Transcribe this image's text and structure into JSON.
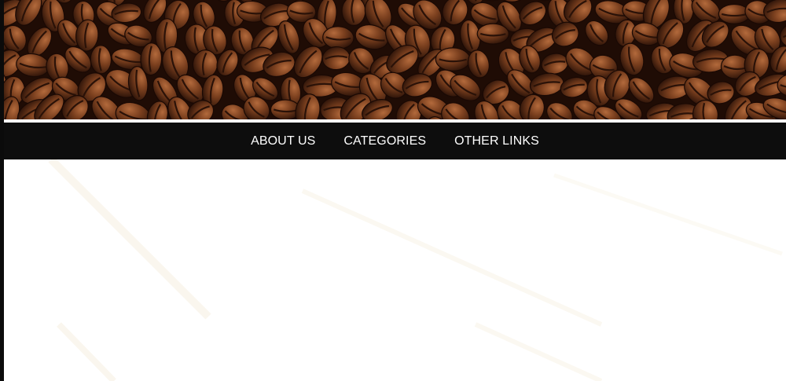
{
  "nav": {
    "items": [
      {
        "label": "ABOUT US"
      },
      {
        "label": "CATEGORIES"
      },
      {
        "label": "OTHER LINKS"
      }
    ]
  },
  "colors": {
    "navbar_bg": "#0d0d0d",
    "nav_text": "#ffffff",
    "banner_base": "#2a1208",
    "page_bg": "#ffffff"
  }
}
